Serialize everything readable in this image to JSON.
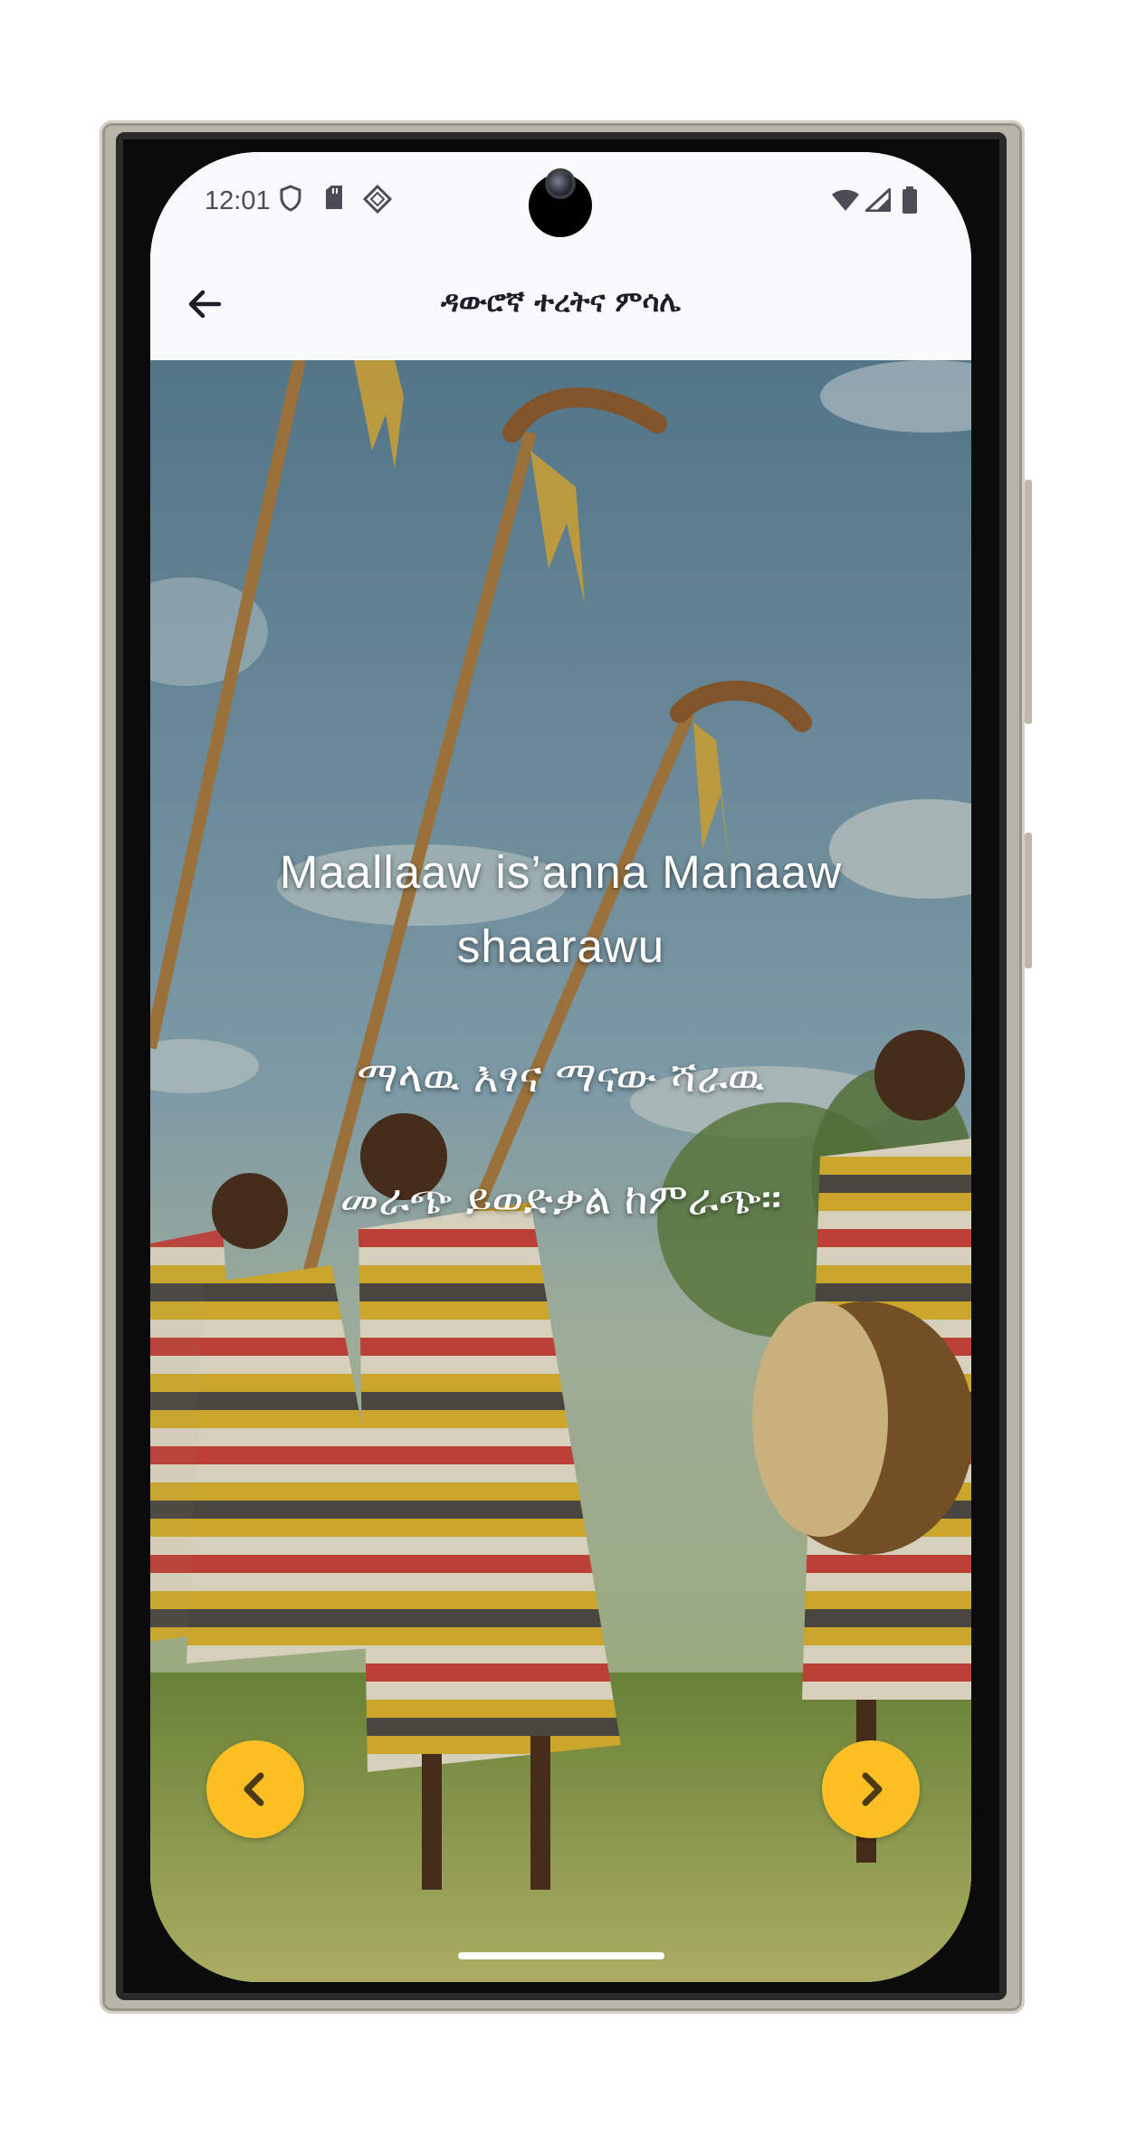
{
  "status_bar": {
    "time": "12:01",
    "icons": [
      "shield-icon",
      "sd-card-icon",
      "diamond-icon",
      "wifi-icon",
      "signal-icon",
      "battery-icon"
    ]
  },
  "app_bar": {
    "title": "ዳውሮኛ ተረትና ምሳሌ",
    "back_icon": "arrow-left-icon"
  },
  "proverb": {
    "dawuro": "Maallaaw is’anna Manaaw shaarawu",
    "line2": "ማላዉ እፃና ማናው ሻራዉ",
    "line3": "መራጭ ይወድቃል ከምራጭ፡፡"
  },
  "navigation": {
    "prev_icon": "chevron-left-icon",
    "next_icon": "chevron-right-icon"
  },
  "colors": {
    "accent": "#fbbf24",
    "appbar_bg": "#f8f9fb",
    "title_text": "#1c1f2a"
  }
}
